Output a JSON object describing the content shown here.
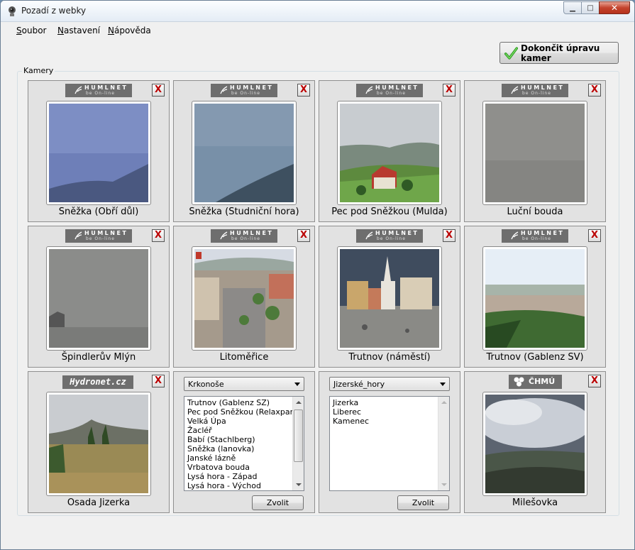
{
  "window": {
    "title": "Pozadí z webky"
  },
  "menu": [
    {
      "first": "S",
      "rest": "oubor"
    },
    {
      "first": "N",
      "rest": "astavení"
    },
    {
      "first": "N",
      "rest": "ápověda"
    }
  ],
  "done_button": {
    "label": "Dokončit úpravu kamer"
  },
  "group": {
    "label": "Kamery"
  },
  "logos": {
    "humlnet": "HUMLNET",
    "humlnet_tag": "be On-line",
    "hydronet": "Hydronet.cz",
    "chmu": "ČHMÚ"
  },
  "remove_label": "X",
  "cameras": [
    {
      "name": "Sněžka (Obří důl)"
    },
    {
      "name": "Sněžka (Studniční hora)"
    },
    {
      "name": "Pec pod Sněžkou (Mulda)"
    },
    {
      "name": "Luční bouda"
    },
    {
      "name": "Špindlerův Mlýn"
    },
    {
      "name": "Litoměřice"
    },
    {
      "name": "Trutnov (náměstí)"
    },
    {
      "name": "Trutnov (Gablenz SV)"
    },
    {
      "name": "Osada Jizerka"
    },
    {
      "name": "Milešovka"
    }
  ],
  "selectors": [
    {
      "region": "Krkonoše",
      "items": [
        "Trutnov (Gablenz SZ)",
        "Pec pod Sněžkou (Relaxpark)",
        "Velká Úpa",
        "Žacléř",
        "Babí (Stachlberg)",
        "Sněžka (lanovka)",
        "Janské lázně",
        "Vrbatova bouda",
        "Lysá hora - Západ",
        "Lysá hora - Východ"
      ],
      "button": "Zvolit"
    },
    {
      "region": "Jizerské_hory",
      "items": [
        "Jizerka",
        "Liberec",
        "Kamenec"
      ],
      "button": "Zvolit"
    }
  ]
}
